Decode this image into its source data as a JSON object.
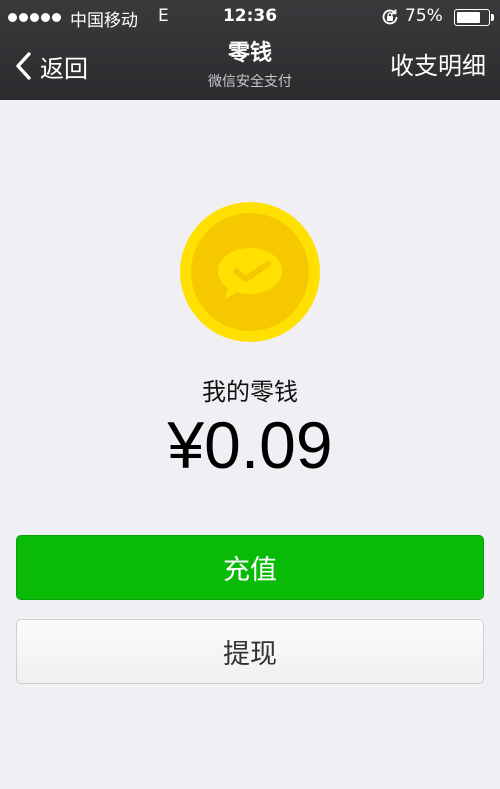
{
  "status_bar": {
    "carrier": "中国移动",
    "network": "E",
    "time": "12:36",
    "battery_percent": "75%",
    "battery_level": 0.75
  },
  "nav": {
    "back_label": "返回",
    "title": "零钱",
    "subtitle": "微信安全支付",
    "right_label": "收支明细"
  },
  "wallet": {
    "label": "我的零钱",
    "amount": "¥0.09"
  },
  "actions": {
    "primary_label": "充值",
    "secondary_label": "提现"
  },
  "colors": {
    "primary_green": "#09bb07",
    "coin_yellow": "#ffe000",
    "nav_bar": "#2c2c2f"
  }
}
